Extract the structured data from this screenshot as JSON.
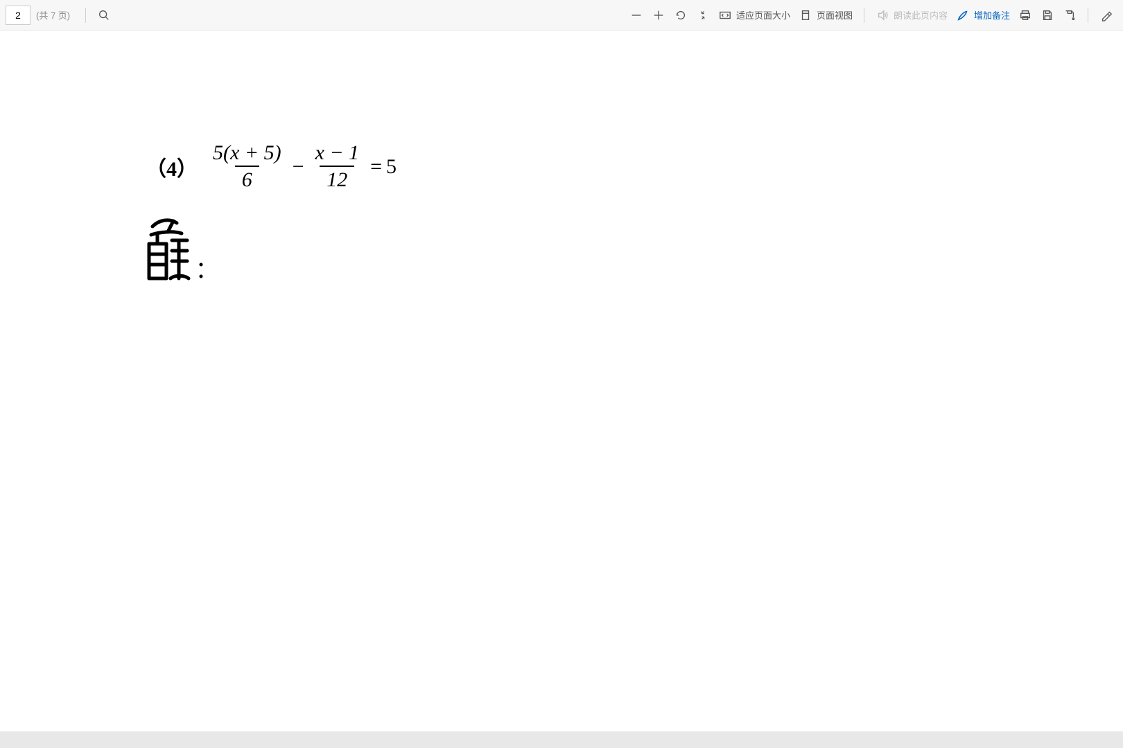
{
  "toolbar": {
    "current_page": "2",
    "page_count_label": "(共 7 页)",
    "fit_page_label": "适应页面大小",
    "page_view_label": "页面视图",
    "read_aloud_label": "朗读此页内容",
    "add_notes_label": "增加备注"
  },
  "document": {
    "problem_number": "（4）",
    "equation": {
      "frac1_num": "5(x + 5)",
      "frac1_den": "6",
      "op1": "−",
      "frac2_num": "x − 1",
      "frac2_den": "12",
      "op2": "=",
      "rhs": "5"
    },
    "handwritten_label": "解:"
  }
}
